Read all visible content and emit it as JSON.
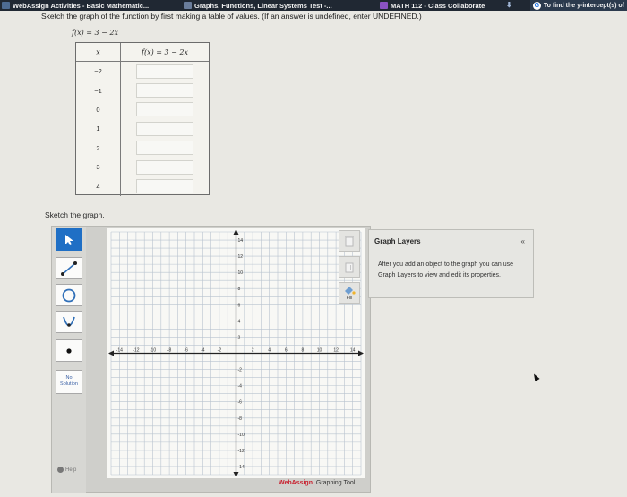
{
  "tabs": [
    {
      "label": "WebAssign Activities - Basic Mathematic...",
      "icon": "webassign-icon",
      "color": "#4d6b92"
    },
    {
      "label": "Graphs, Functions, Linear Systems Test -...",
      "icon": "webassign-w-icon",
      "color": "#6a7d9b"
    },
    {
      "label": "MATH 112 - Class Collaborate",
      "icon": "collaborate-icon",
      "color": "#8a52c5"
    }
  ],
  "extra_tab": {
    "label": "To find the y-intercept(s) of",
    "icon": "google-icon"
  },
  "problem": {
    "instructions": "Sketch the graph of the function by first making a table of values. (If an answer is undefined, enter UNDEFINED.)",
    "function": "f(x) = 3 − 2x"
  },
  "table": {
    "headers": [
      "x",
      "f(x) = 3 − 2x"
    ],
    "x_values": [
      "−2",
      "−1",
      "0",
      "1",
      "2",
      "3",
      "4"
    ]
  },
  "sketch_label": "Sketch the graph.",
  "graph": {
    "x_tick_labels": [
      "-14",
      "-12",
      "-10",
      "-8",
      "-6",
      "-4",
      "-2",
      "2",
      "4",
      "6",
      "8",
      "10",
      "12",
      "14"
    ],
    "y_tick_labels": [
      "14",
      "12",
      "10",
      "8",
      "6",
      "4",
      "2",
      "-2",
      "-4",
      "-6",
      "-8",
      "-10",
      "-12",
      "-14"
    ],
    "grid_range": [
      -15,
      15
    ]
  },
  "tools": {
    "no_solution_label": "No Solution",
    "help_label": "Help",
    "fill_label": "Fill"
  },
  "brand": {
    "name": "WebAssign",
    "suffix": ". Graphing Tool"
  },
  "layers": {
    "title": "Graph Layers",
    "collapse": "«",
    "message": "After you add an object to the graph you can use Graph Layers to view and edit its properties."
  }
}
